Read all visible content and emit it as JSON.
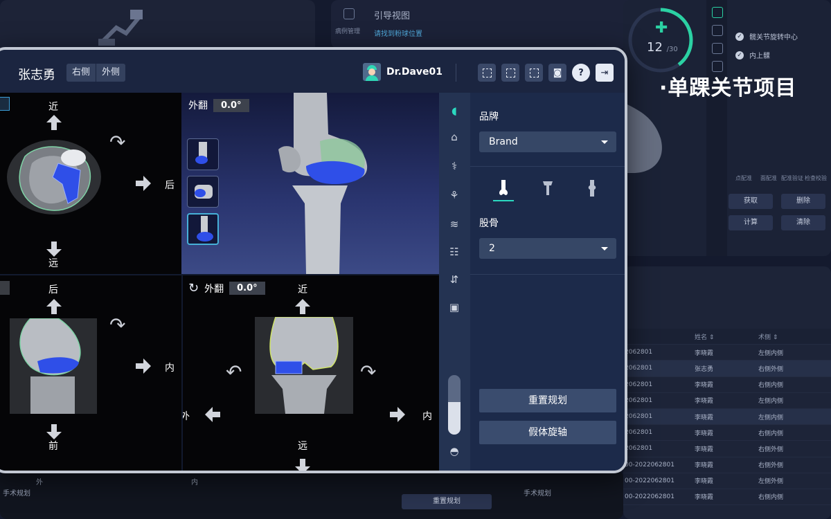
{
  "tagline": "·单踝关节项目",
  "background": {
    "top_left_nav": [
      "病例管理"
    ],
    "guide": {
      "title": "引导视图",
      "hint": "请找到粉球位置"
    },
    "progress": {
      "current": 12,
      "total": "/30"
    },
    "checklist": [
      "髋关节旋转中心",
      "内上髁"
    ],
    "tools": [
      "点配准",
      "面配准",
      "配准验证",
      "检查校验"
    ],
    "buttons": [
      "获取",
      "删除",
      "计算",
      "清除"
    ],
    "table": {
      "headers": [
        "姓名 ⇕",
        "术侧 ⇕"
      ],
      "rows": [
        [
          "2062801",
          "李晓霞",
          "左侧内侧"
        ],
        [
          "2062801",
          "张志勇",
          "右侧外侧"
        ],
        [
          "2062801",
          "李晓霞",
          "右侧内侧"
        ],
        [
          "2062801",
          "李晓霞",
          "左侧内侧"
        ],
        [
          "2062801",
          "李晓霞",
          "左侧内侧"
        ],
        [
          "2062801",
          "李晓霞",
          "右侧内侧"
        ],
        [
          "2062801",
          "李晓霞",
          "右侧外侧"
        ],
        [
          "00-2022062801",
          "李晓霞",
          "右侧外侧"
        ],
        [
          "00-2022062801",
          "李晓霞",
          "左侧外侧"
        ],
        [
          "00-2022062801",
          "李晓霞",
          "右侧内侧"
        ]
      ]
    },
    "bottom": {
      "nav_label": "手术规划",
      "left_label": "外",
      "mid_label": "内",
      "reset_btn": "重置规划",
      "nav_label_2": "手术规划"
    }
  },
  "window": {
    "patient_name": "张志勇",
    "side_options": [
      "右侧",
      "外侧"
    ],
    "user": "Dr.Dave01",
    "toolbar_icons": [
      "frame-icon",
      "frame-icon",
      "frame-icon",
      "screenshot-icon",
      "help-icon",
      "logout-icon"
    ]
  },
  "views": {
    "axial": {
      "top": "近",
      "bottom": "远",
      "right": "后"
    },
    "threed": {
      "angle_label": "外翻",
      "angle_value": "0.0°"
    },
    "sagittal": {
      "top": "后",
      "bottom": "前",
      "right": "内"
    },
    "coronal": {
      "angle_label": "外翻",
      "angle_value": "0.0°",
      "top": "近",
      "bottom": "远",
      "left": "外",
      "right": "内"
    }
  },
  "tool_column": {
    "slider_level": 0.55
  },
  "panel": {
    "brand_label": "品牌",
    "brand_value": "Brand",
    "bone_label": "股骨",
    "bone_value": "2",
    "reset_button": "重置规划",
    "rotate_button": "假体旋轴"
  },
  "colors": {
    "accent": "#2bd9c0",
    "implant": "#2f4fe8",
    "background": "#141a2e"
  }
}
